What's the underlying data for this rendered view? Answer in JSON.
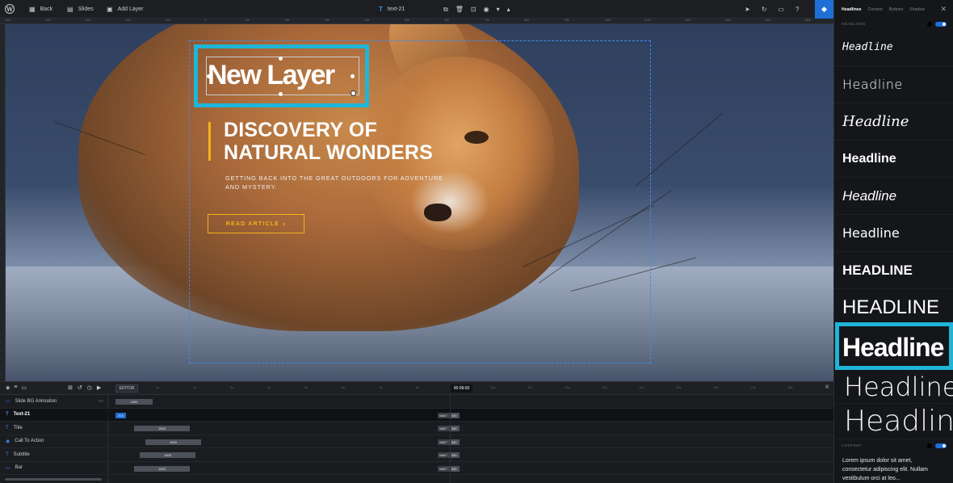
{
  "topbar": {
    "back_label": "Back",
    "slides_label": "Slides",
    "add_layer_label": "Add Layer",
    "layer_name": "text-21"
  },
  "ruler": {
    "ticks": [
      "-500",
      "-400",
      "-300",
      "-200",
      "-100",
      "0",
      "100",
      "200",
      "300",
      "400",
      "500",
      "600",
      "700",
      "800",
      "900",
      "1000",
      "1100",
      "1200",
      "1300",
      "1400",
      "1500",
      "1600"
    ]
  },
  "canvas": {
    "new_layer_text": "New Layer",
    "headline": "DISCOVERY OF\nNATURAL WONDERS",
    "subheadline": "GETTING BACK INTO THE GREAT OUTDOORS FOR ADVENTURE\nAND MYSTERY.",
    "cta_label": "READ ARTICLE",
    "cta_arrow": "›",
    "accent_color": "#f2b31c",
    "selection_color": "#1fb5d8"
  },
  "timeline": {
    "editor_label": "EDITOR",
    "time_display": "00:09:00",
    "time_marks": [
      "1s",
      "2s",
      "3s",
      "4s",
      "5s",
      "6s",
      "7s",
      "8s",
      "9s",
      "10s",
      "11s",
      "12s",
      "13s",
      "14s",
      "15s",
      "16s",
      "17s",
      "18s"
    ],
    "rows": [
      {
        "label": "Slide BG Animation",
        "bar": "1000"
      },
      {
        "label": "Text-21",
        "bar": "300",
        "wait": "WAIT",
        "wait_val": "300"
      },
      {
        "label": "Title",
        "bar": "1500",
        "wait": "WAIT",
        "wait_val": "300"
      },
      {
        "label": "Call To Action",
        "bar": "1500",
        "wait": "WAIT",
        "wait_val": "300"
      },
      {
        "label": "Subtitle",
        "bar": "1500",
        "wait": "WAIT",
        "wait_val": "300"
      },
      {
        "label": "Bar",
        "bar": "1000",
        "wait": "WAIT",
        "wait_val": "300"
      }
    ]
  },
  "panel": {
    "tabs": [
      "Headlines",
      "Content",
      "Buttons",
      "Shadow"
    ],
    "headlines_header": "HEADLINES",
    "content_header": "CONTENT",
    "headline_samples": [
      "Headline",
      "Headline",
      "Headline",
      "Headline",
      "Headline",
      "Headline",
      "HEADLINE",
      "HEADLINE",
      "Headline",
      "Headline",
      "Headline"
    ],
    "lorem": "Lorem ipsum dolor sit amet,\nconsectetur adipiscing elit. Nullam\nvestibulum orci at leo..."
  }
}
